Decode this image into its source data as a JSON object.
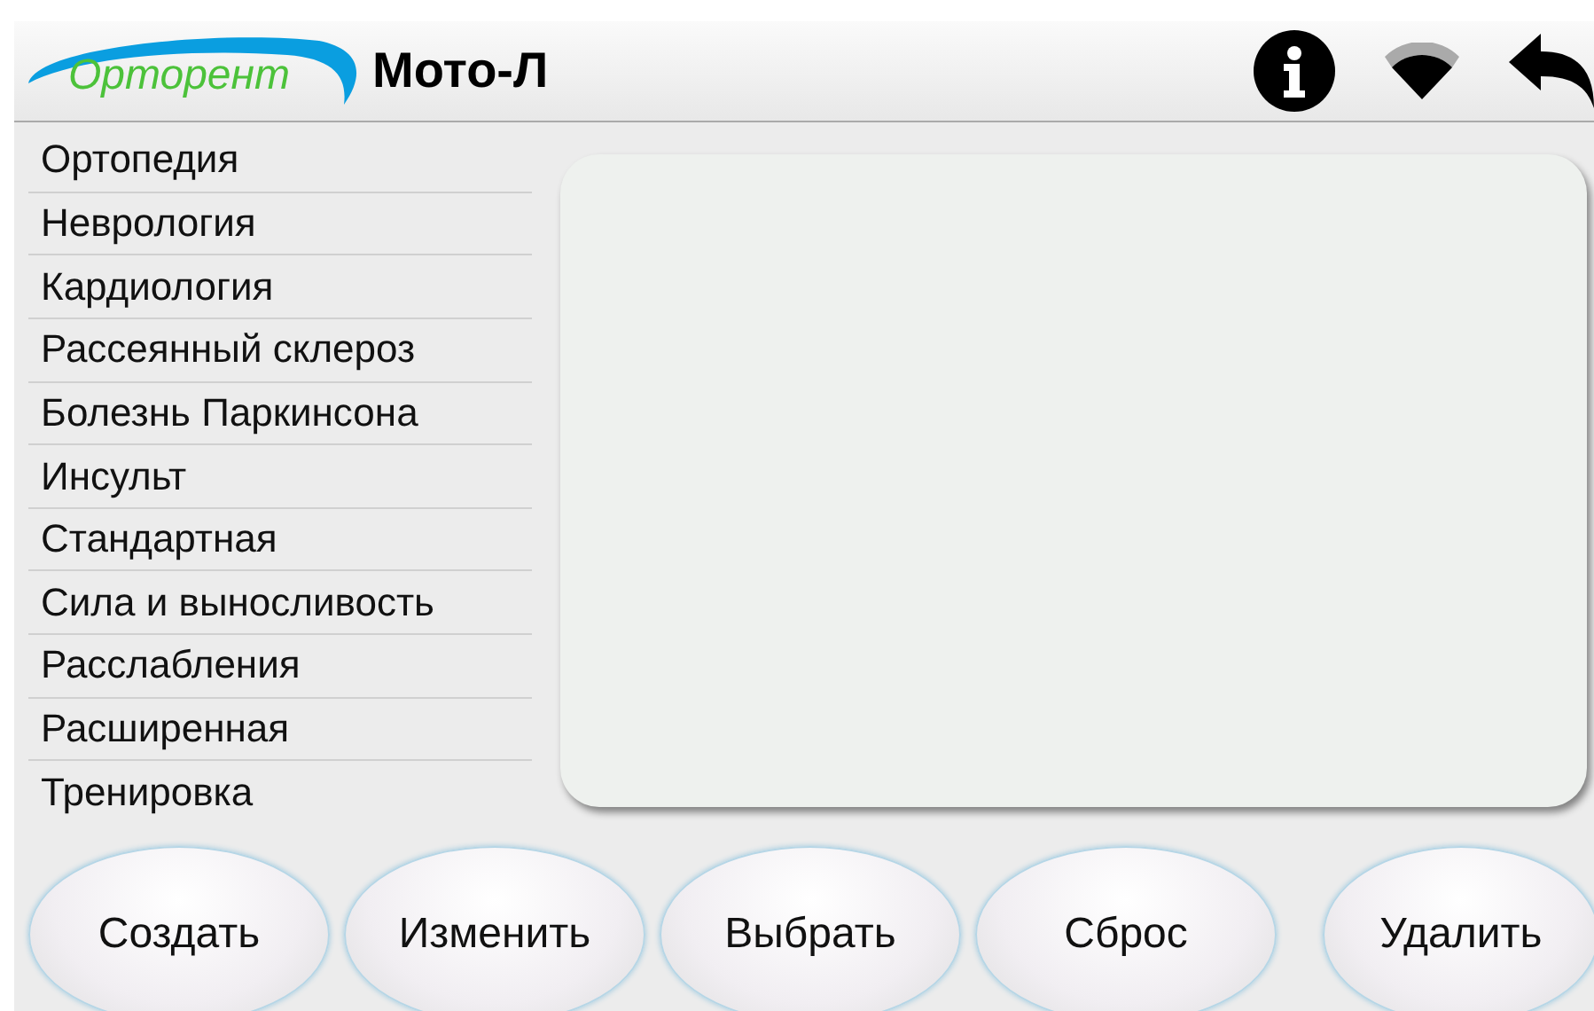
{
  "header": {
    "logo": "Орторент",
    "title": "Мото-Л"
  },
  "programs": [
    {
      "label": "Ортопедия"
    },
    {
      "label": "Неврология"
    },
    {
      "label": "Кардиология"
    },
    {
      "label": "Рассеянный склероз"
    },
    {
      "label": "Болезнь Паркинсона"
    },
    {
      "label": "Инсульт"
    },
    {
      "label": "Стандартная"
    },
    {
      "label": "Сила и выносливость"
    },
    {
      "label": "Расслабления"
    },
    {
      "label": "Расширенная"
    },
    {
      "label": "Тренировка"
    }
  ],
  "buttons": [
    {
      "label": "Создать"
    },
    {
      "label": "Изменить"
    },
    {
      "label": "Выбрать"
    },
    {
      "label": "Сброс"
    },
    {
      "label": "Удалить"
    }
  ]
}
